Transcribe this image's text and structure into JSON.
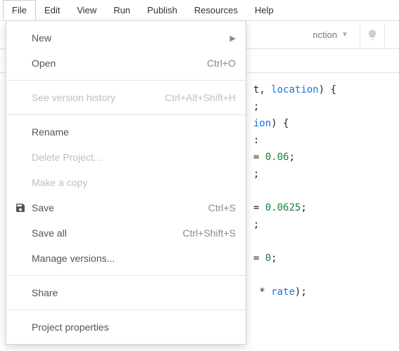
{
  "menubar": {
    "items": [
      {
        "label": "File",
        "active": true
      },
      {
        "label": "Edit"
      },
      {
        "label": "View"
      },
      {
        "label": "Run"
      },
      {
        "label": "Publish"
      },
      {
        "label": "Resources"
      },
      {
        "label": "Help"
      }
    ]
  },
  "toolbar": {
    "function_label": "nction"
  },
  "dropdown": {
    "groups": [
      [
        {
          "label": "New",
          "submenu": true
        },
        {
          "label": "Open",
          "shortcut": "Ctrl+O"
        }
      ],
      [
        {
          "label": "See version history",
          "shortcut": "Ctrl+Alt+Shift+H",
          "disabled": true
        }
      ],
      [
        {
          "label": "Rename"
        },
        {
          "label": "Delete Project...",
          "disabled": true
        },
        {
          "label": "Make a copy",
          "disabled": true
        },
        {
          "label": "Save",
          "shortcut": "Ctrl+S",
          "icon": "save-icon"
        },
        {
          "label": "Save all",
          "shortcut": "Ctrl+Shift+S"
        },
        {
          "label": "Manage versions..."
        }
      ],
      [
        {
          "label": "Share"
        }
      ],
      [
        {
          "label": "Project properties"
        }
      ]
    ]
  },
  "code": {
    "lines": [
      {
        "text_plain": "t, ",
        "text_kw": "location",
        "text_after": ") {"
      },
      {
        "text_plain": ";"
      },
      {
        "text_kw": "ion",
        "text_after": ") {"
      },
      {
        "text_plain": ":"
      },
      {
        "text_assign": "= ",
        "num": "0.06",
        "after": ";"
      },
      {
        "text_plain": ";"
      },
      {
        "text_plain": ""
      },
      {
        "text_assign": "= ",
        "num": "0.0625",
        "after": ";"
      },
      {
        "text_plain": ";"
      },
      {
        "text_plain": ""
      },
      {
        "text_assign": "= ",
        "num": "0",
        "after": ";"
      },
      {
        "text_plain": ""
      },
      {
        "text_plain": " * ",
        "text_kw2": "rate",
        "after2": ");"
      }
    ]
  }
}
